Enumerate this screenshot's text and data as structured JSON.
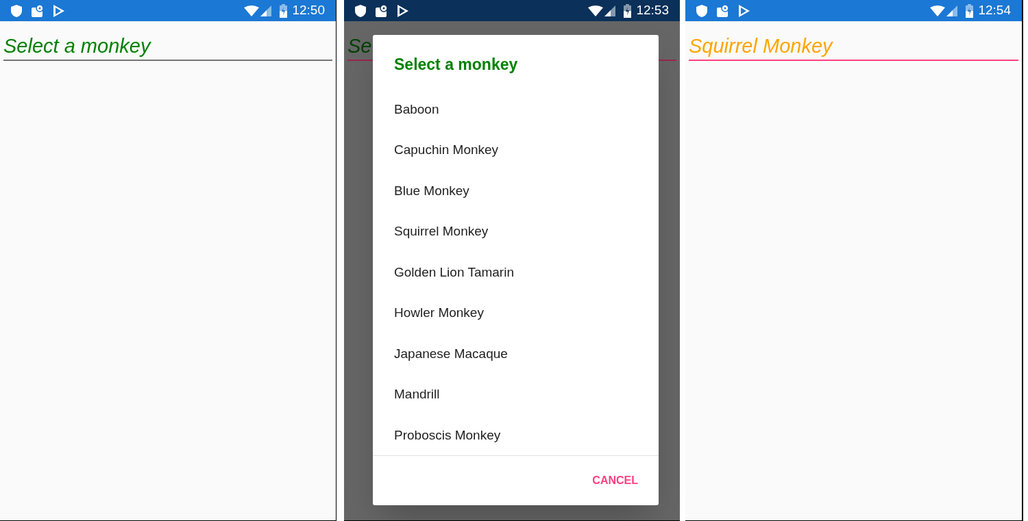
{
  "screens": [
    {
      "status_bar": {
        "time": "12:50"
      },
      "dimmed": false,
      "picker": {
        "text": "Select a monkey",
        "color": "#008000",
        "focused": false
      }
    },
    {
      "status_bar": {
        "time": "12:53"
      },
      "dimmed": true,
      "picker": {
        "text": "Se",
        "color": "#004000",
        "focused": true
      },
      "dialog": {
        "title": "Select a monkey",
        "items": [
          "Baboon",
          "Capuchin Monkey",
          "Blue Monkey",
          "Squirrel Monkey",
          "Golden Lion Tamarin",
          "Howler Monkey",
          "Japanese Macaque",
          "Mandrill",
          "Proboscis Monkey"
        ],
        "cancel": "CANCEL"
      }
    },
    {
      "status_bar": {
        "time": "12:54"
      },
      "dimmed": false,
      "picker": {
        "text": "Squirrel Monkey",
        "color": "#ffa500",
        "focused": true
      }
    }
  ]
}
